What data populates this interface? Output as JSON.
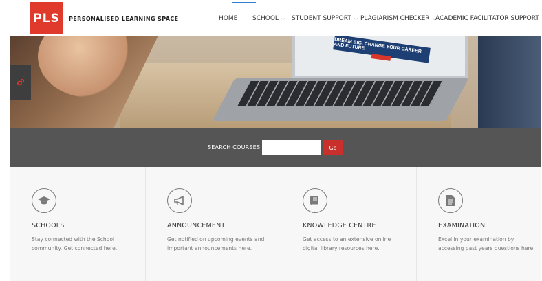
{
  "header": {
    "logo_text": "PLS",
    "brand": "PERSONALISED LEARNING SPACE",
    "accent_color": "#e03a2d",
    "nav": [
      {
        "label": "HOME",
        "has_dropdown": false
      },
      {
        "label": "SCHOOL",
        "has_dropdown": true
      },
      {
        "label": "STUDENT SUPPORT",
        "has_dropdown": true
      },
      {
        "label": "PLAGIARISM CHECKER",
        "has_dropdown": true
      },
      {
        "label": "ACADEMIC FACILITATOR SUPPORT",
        "has_dropdown": true
      }
    ]
  },
  "hero": {
    "banner_text": "DREAM BIG, CHANGE YOUR CAREER AND FUTURE"
  },
  "search": {
    "label": "SEARCH COURSES",
    "value": "",
    "placeholder": "",
    "button_label": "Go",
    "button_color": "#c9302c"
  },
  "cards": [
    {
      "icon": "graduation-cap-icon",
      "title": "SCHOOLS",
      "desc": "Stay connected with the School community. Get connected here."
    },
    {
      "icon": "megaphone-icon",
      "title": "ANNOUNCEMENT",
      "desc": "Get notified on upcoming events and important announcements here."
    },
    {
      "icon": "book-icon",
      "title": "KNOWLEDGE CENTRE",
      "desc": "Get access to an extensive online digital library resources here."
    },
    {
      "icon": "document-icon",
      "title": "EXAMINATION",
      "desc": "Excel in your examination by accessing past years questions here."
    }
  ]
}
